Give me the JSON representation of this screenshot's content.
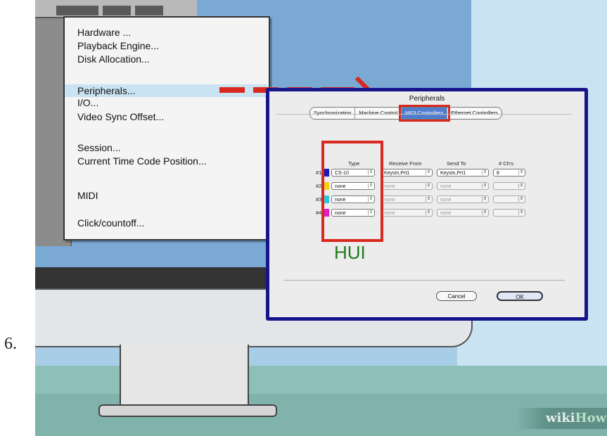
{
  "step_number": "6.",
  "menu": {
    "items": [
      "Hardware ...",
      "Playback Engine...",
      "Disk Allocation...",
      "Peripherals...",
      "I/O...",
      "Video Sync Offset...",
      "Session...",
      "Current Time Code Position...",
      "MIDI",
      "Click/countoff..."
    ]
  },
  "dialog": {
    "title": "Peripherals",
    "tabs": [
      "Synchronization",
      "Machine Control",
      "MIDI Controllers",
      "Ethernet Controllers"
    ],
    "active_tab": "MIDI Controllers",
    "columns": [
      "Type",
      "Receive From",
      "Send To",
      "# Ch's"
    ],
    "rows": [
      {
        "label": "#1",
        "color": "#1a1ab4",
        "type": "CS-10",
        "receive": "Keystn,Prt1",
        "send": "Keystn,Prt1",
        "channels": "8"
      },
      {
        "label": "#2",
        "color": "#f2d21a",
        "type": "none",
        "receive": "none",
        "send": "none",
        "channels": ""
      },
      {
        "label": "#3",
        "color": "#2ec9d6",
        "type": "none",
        "receive": "none",
        "send": "none",
        "channels": ""
      },
      {
        "label": "#4",
        "color": "#e01ec8",
        "type": "none",
        "receive": "none",
        "send": "none",
        "channels": ""
      }
    ],
    "annotation": "HUI",
    "cancel_label": "Cancel",
    "ok_label": "OK"
  },
  "watermark": {
    "part1": "wiki",
    "part2": "How"
  },
  "colors": {
    "highlight_red": "#d8281f",
    "dialog_border": "#17148c",
    "hui_green": "#1f7a1f"
  }
}
